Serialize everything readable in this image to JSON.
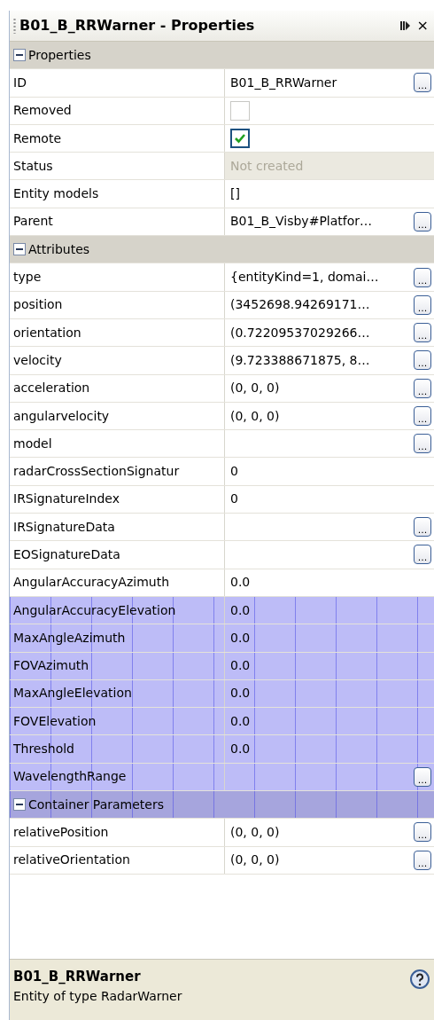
{
  "window": {
    "title": "B01_B_RRWarner - Properties",
    "close": "×"
  },
  "groups": [
    {
      "title": "Properties",
      "expanded": true,
      "highlighted": false,
      "rows": [
        {
          "kind": "text",
          "label": "ID",
          "value": "B01_B_RRWarner",
          "button": "...",
          "highlighted": false
        },
        {
          "kind": "checkbox",
          "label": "Removed",
          "checked": false,
          "highlighted": false
        },
        {
          "kind": "checkbox",
          "label": "Remote",
          "checked": true,
          "highlighted": false
        },
        {
          "kind": "combo",
          "label": "Status",
          "value": "Not created",
          "disabled": true,
          "highlighted": false
        },
        {
          "kind": "text",
          "label": "Entity models",
          "value": "[]",
          "highlighted": false
        },
        {
          "kind": "text",
          "label": "Parent",
          "value": "B01_B_Visby#Platfor…",
          "button": "...",
          "highlighted": false
        }
      ]
    },
    {
      "title": "Attributes",
      "expanded": true,
      "highlighted": false,
      "rows": [
        {
          "kind": "text",
          "label": "type",
          "value": "{entityKind=1, domai…",
          "button": "...",
          "highlighted": false
        },
        {
          "kind": "text",
          "label": "position",
          "value": "(3452698.94269171…",
          "button": "...",
          "highlighted": false
        },
        {
          "kind": "text",
          "label": "orientation",
          "value": "(0.72209537029266…",
          "button": "...",
          "highlighted": false
        },
        {
          "kind": "text",
          "label": "velocity",
          "value": "(9.723388671875, 8…",
          "button": "...",
          "highlighted": false
        },
        {
          "kind": "text",
          "label": "acceleration",
          "value": "(0, 0, 0)",
          "button": "...",
          "highlighted": false
        },
        {
          "kind": "text",
          "label": "angularvelocity",
          "value": "(0, 0, 0)",
          "button": "...",
          "highlighted": false
        },
        {
          "kind": "text",
          "label": "model",
          "button": "...",
          "highlighted": false
        },
        {
          "kind": "text",
          "label": "radarCrossSectionSignatur",
          "value": "0",
          "highlighted": false
        },
        {
          "kind": "text",
          "label": "IRSignatureIndex",
          "value": "0",
          "highlighted": false
        },
        {
          "kind": "text",
          "label": "IRSignatureData",
          "button": "...",
          "highlighted": false
        },
        {
          "kind": "text",
          "label": "EOSignatureData",
          "button": "...",
          "highlighted": false
        },
        {
          "kind": "text",
          "label": "AngularAccuracyAzimuth",
          "value": "0.0",
          "highlighted": false
        },
        {
          "kind": "text",
          "label": "AngularAccuracyElevation",
          "value": "0.0",
          "highlighted": true
        },
        {
          "kind": "text",
          "label": "MaxAngleAzimuth",
          "value": "0.0",
          "highlighted": true
        },
        {
          "kind": "text",
          "label": "FOVAzimuth",
          "value": "0.0",
          "highlighted": true
        },
        {
          "kind": "text",
          "label": "MaxAngleElevation",
          "value": "0.0",
          "highlighted": true
        },
        {
          "kind": "text",
          "label": "FOVElevation",
          "value": "0.0",
          "highlighted": true
        },
        {
          "kind": "text",
          "label": "Threshold",
          "value": "0.0",
          "highlighted": true
        },
        {
          "kind": "text",
          "label": "WavelengthRange",
          "button": "...",
          "highlighted": true
        }
      ]
    },
    {
      "title": "Container Parameters",
      "expanded": true,
      "highlighted": true,
      "rows": [
        {
          "kind": "text",
          "label": "relativePosition",
          "value": "(0, 0, 0)",
          "button": "...",
          "highlighted": false
        },
        {
          "kind": "text",
          "label": "relativeOrientation",
          "value": "(0, 0, 0)",
          "button": "...",
          "highlighted": false
        }
      ]
    }
  ],
  "description": {
    "title": "B01_B_RRWarner",
    "text": "Entity of type RadarWarner"
  }
}
